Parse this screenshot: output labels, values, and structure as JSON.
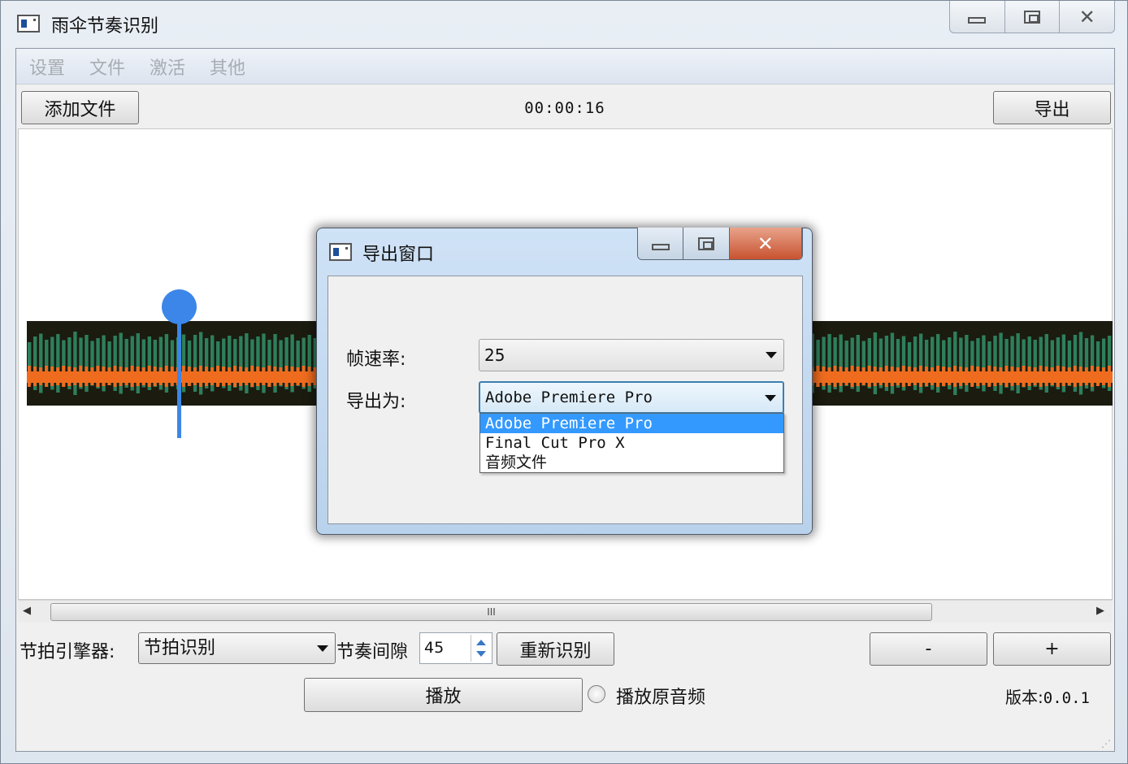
{
  "main": {
    "title": "雨伞节奏识别",
    "menu": [
      "设置",
      "文件",
      "激活",
      "其他"
    ],
    "add_file_label": "添加文件",
    "timecode": "00:00:16",
    "export_label": "导出",
    "scroll_thumb": "III",
    "engine_label": "节拍引擎器:",
    "engine_value": "节拍识别",
    "gap_label": "节奏间隙",
    "gap_value": "45",
    "rerecognize_label": "重新识别",
    "minus_label": "-",
    "plus_label": "+",
    "play_label": "播放",
    "original_audio_label": "播放原音频",
    "version_label": "版本:",
    "version_value": "0.0.1",
    "playhead_fraction": 0.14
  },
  "dialog": {
    "title": "导出窗口",
    "fps_label": "帧速率:",
    "fps_value": "25",
    "format_label": "导出为:",
    "format_value": "Adobe Premiere Pro",
    "format_options": [
      "Adobe Premiere Pro",
      "Final Cut Pro X",
      "音频文件"
    ],
    "selected_option": 0
  },
  "colors": {
    "wave_green": "#2e7f5c",
    "wave_orange": "#ef6c1f",
    "wave_dark": "#1b1b10",
    "playhead": "#3b86e8",
    "selection": "#3399ff"
  },
  "icons": [
    "app-icon",
    "minimize-icon",
    "maximize-icon",
    "close-icon",
    "chevron-down-icon",
    "spin-up-icon",
    "spin-down-icon",
    "scroll-left-icon",
    "scroll-right-icon"
  ]
}
